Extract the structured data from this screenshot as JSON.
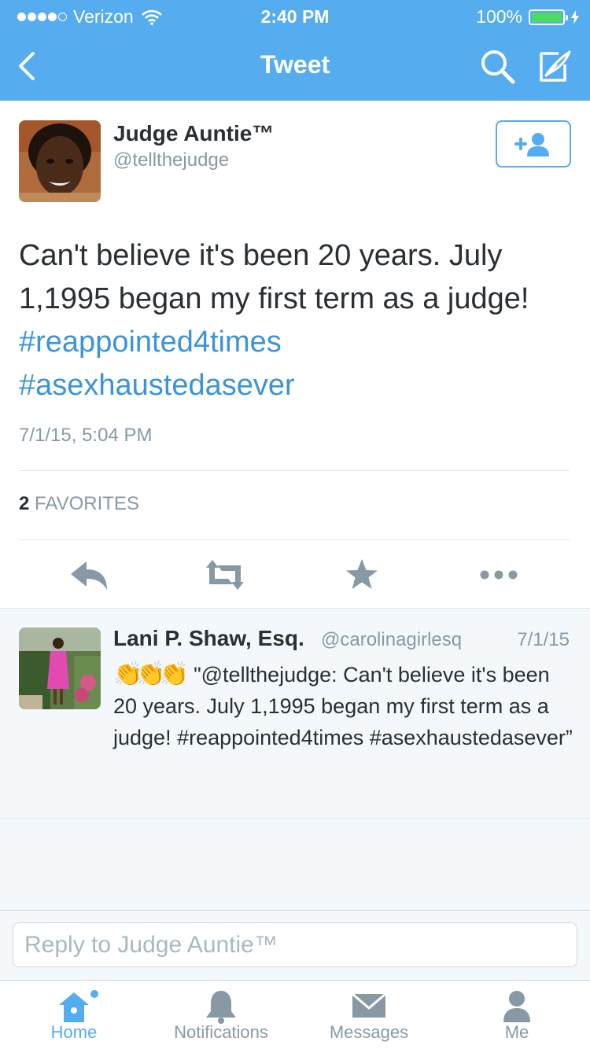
{
  "status_bar": {
    "carrier": "Verizon",
    "time": "2:40 PM",
    "battery": "100%"
  },
  "nav": {
    "title": "Tweet"
  },
  "tweet": {
    "author_name": "Judge Auntie™",
    "author_handle": "@tellthejudge",
    "text": "Can't believe it's been 20 years. July 1,1995 began my first term as a judge!",
    "hashtags": [
      "#reappointed4times",
      "#asexhaustedasever"
    ],
    "date": "7/1/15, 5:04 PM",
    "favorites_count": "2",
    "favorites_label": "FAVORITES"
  },
  "reply": {
    "author_name": "Lani P. Shaw, Esq.",
    "author_handle": "@carolinagirlesq",
    "date": "7/1/15",
    "emoji": "👏👏👏",
    "text": "\"@tellthejudge: Can't believe it's been 20 years. July 1,1995 began my first term as a judge! #reappointed4times #asexhaustedasever”"
  },
  "reply_input": {
    "placeholder": "Reply to Judge Auntie™"
  },
  "tabs": [
    {
      "label": "Home",
      "icon": "home-icon",
      "active": true
    },
    {
      "label": "Notifications",
      "icon": "bell-icon",
      "active": false
    },
    {
      "label": "Messages",
      "icon": "envelope-icon",
      "active": false
    },
    {
      "label": "Me",
      "icon": "person-icon",
      "active": false
    }
  ],
  "colors": {
    "brand": "#55acee",
    "link": "#3b94d9",
    "muted": "#8899a6",
    "battery": "#4cd964"
  }
}
